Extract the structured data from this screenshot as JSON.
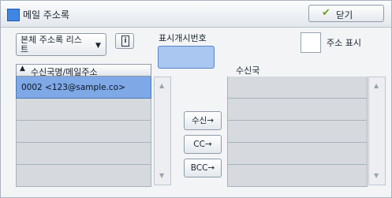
{
  "window": {
    "title": "메일 주소록",
    "close_label": "닫기"
  },
  "address_book": {
    "selected": "본체 주소록 리스트"
  },
  "start_number": {
    "label": "표시개시번호",
    "value": ""
  },
  "show_address": {
    "label": "주소 표시",
    "checked": false
  },
  "list_header": {
    "label": "수신국명/메일주소"
  },
  "entries": [
    "0002 <123@sample.co>",
    "",
    "",
    "",
    ""
  ],
  "actions": {
    "to": "수신→",
    "cc": "CC→",
    "bcc": "BCC→"
  },
  "recipients": {
    "label": "수신국",
    "items": [
      "",
      "",
      "",
      "",
      ""
    ]
  },
  "colors": {
    "accent": "#3f87e3",
    "selection": "#7ea8e6",
    "check": "#6aa21e"
  }
}
